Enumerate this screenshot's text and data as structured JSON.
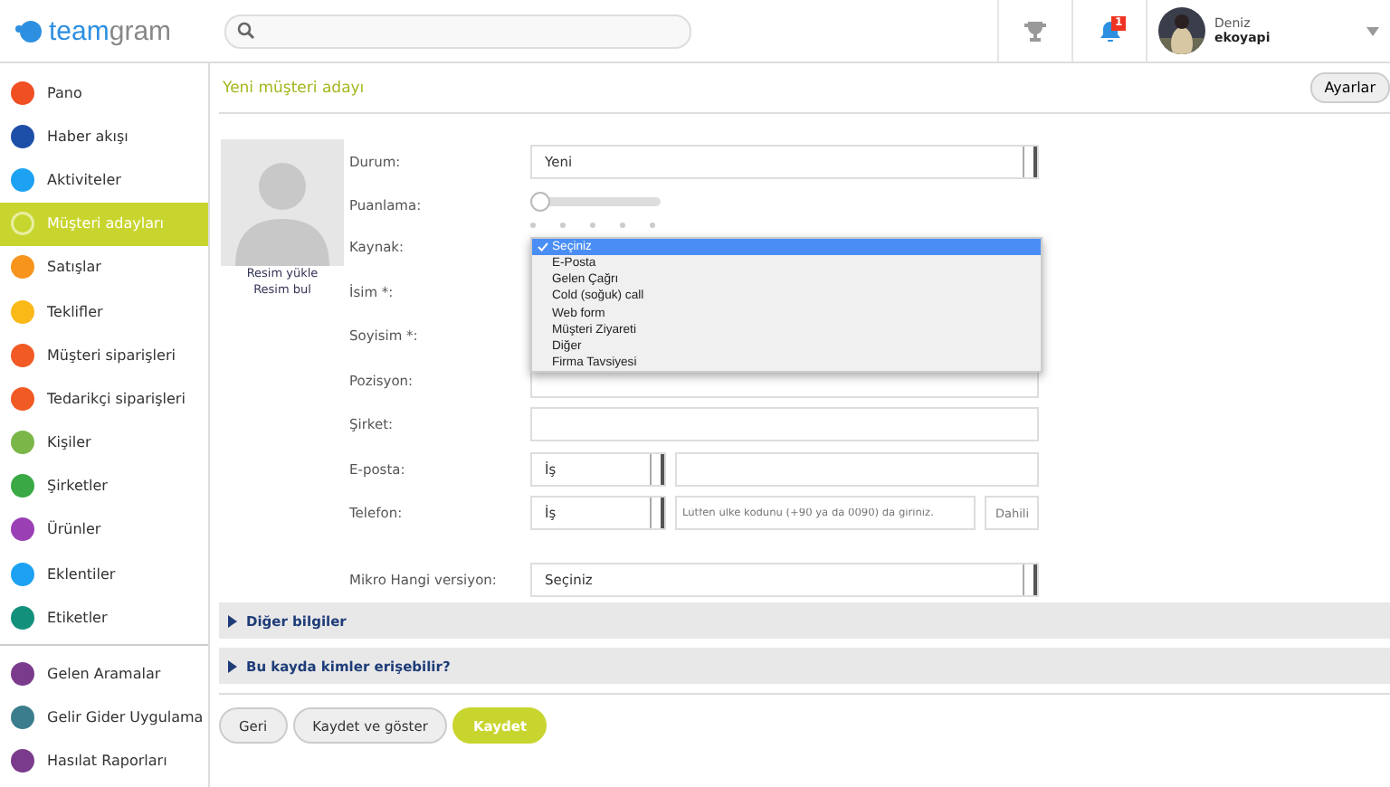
{
  "header": {
    "logo": {
      "first": "team",
      "second": "gram"
    },
    "notifications": {
      "count": "1"
    },
    "user": {
      "name": "Deniz",
      "company": "ekoyapi"
    }
  },
  "sidebar": {
    "items": [
      {
        "label": "Pano",
        "color": "#f04e23",
        "selected": false
      },
      {
        "label": "Haber akışı",
        "color": "#1e4fa8",
        "selected": false
      },
      {
        "label": "Aktiviteler",
        "color": "#1da1f2",
        "selected": false
      },
      {
        "label": "Müşteri adayları",
        "color": "#c7d62f",
        "selected": true
      },
      {
        "label": "Satışlar",
        "color": "#f7941d",
        "selected": false
      },
      {
        "label": "Teklifler",
        "color": "#fbb917",
        "selected": false
      },
      {
        "label": "Müşteri siparişleri",
        "color": "#f15a24",
        "selected": false
      },
      {
        "label": "Tedarikçi siparişleri",
        "color": "#f15a24",
        "selected": false
      },
      {
        "label": "Kişiler",
        "color": "#7ab648",
        "selected": false
      },
      {
        "label": "Şirketler",
        "color": "#39a845",
        "selected": false
      },
      {
        "label": "Ürünler",
        "color": "#9b3fb5",
        "selected": false
      },
      {
        "label": "Eklentiler",
        "color": "#1da1f2",
        "selected": false
      },
      {
        "label": "Etiketler",
        "color": "#12907c",
        "selected": false
      }
    ],
    "apps": [
      {
        "label": "Gelen Aramalar",
        "color": "#7b3b8c",
        "selected": false
      },
      {
        "label": "Gelir Gider Uygulama",
        "color": "#3b7d8c",
        "selected": false
      },
      {
        "label": "Hasılat Raporları",
        "color": "#7b3b8c",
        "selected": false
      }
    ]
  },
  "page": {
    "title": "Yeni müşteri adayı",
    "settings_button": "Ayarlar",
    "photo_links": [
      "Resim yükle",
      "Resim bul"
    ],
    "fields": [
      {
        "kind": "select",
        "label": "Durum:",
        "value": "Yeni"
      },
      {
        "kind": "slider",
        "label": "Puanlama:",
        "level": 0
      },
      {
        "kind": "dropdown",
        "label": "Kaynak:",
        "options": [
          {
            "label": "Seçiniz",
            "selected": true
          },
          {
            "label": "E-Posta",
            "selected": false
          },
          {
            "label": "Gelen Çağrı",
            "selected": false
          },
          {
            "label": "Cold (soğuk) call",
            "selected": false
          },
          {
            "label": "Web form",
            "selected": false
          },
          {
            "label": "Müşteri Ziyareti",
            "selected": false
          },
          {
            "label": "Diğer",
            "selected": false
          },
          {
            "label": "Firma Tavsiyesi",
            "selected": false
          }
        ]
      },
      {
        "kind": "hidden",
        "label": "İsim *:"
      },
      {
        "kind": "hidden",
        "label": "Soyisim *:"
      },
      {
        "kind": "text",
        "label": "Pozisyon:"
      },
      {
        "kind": "text",
        "label": "Şirket:"
      },
      {
        "kind": "typed",
        "label": "E-posta:",
        "type": "İş"
      },
      {
        "kind": "phone",
        "label": "Telefon:",
        "type": "İş",
        "placeholder": "Lütfen ülke kodunu (+90 ya da 0090) da giriniz.",
        "ext_placeholder": "Dahili"
      },
      {
        "kind": "select",
        "label": "Mikro Hangi versiyon:",
        "value": "Seçiniz"
      }
    ],
    "sections": [
      "Diğer bilgiler",
      "Bu kayda kimler erişebilir?"
    ],
    "buttons": [
      {
        "label": "Geri",
        "kind": "plain"
      },
      {
        "label": "Kaydet ve göster",
        "kind": "plain"
      },
      {
        "label": "Kaydet",
        "kind": "primary"
      }
    ]
  }
}
